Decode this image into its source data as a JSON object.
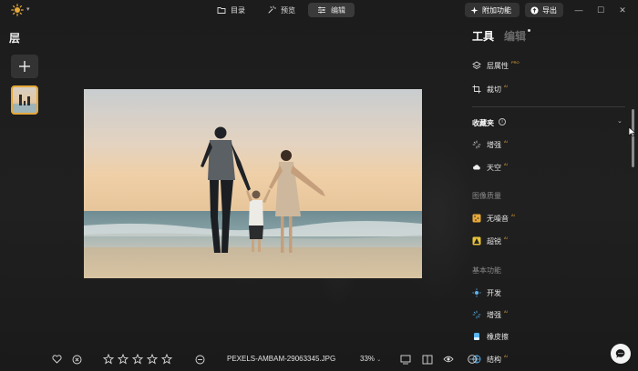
{
  "app": {
    "logo_icon": "sun-logo-icon",
    "accent_color": "#e6a83a"
  },
  "topbar": {
    "tabs": [
      {
        "label": "目录",
        "icon": "folder-icon",
        "active": false
      },
      {
        "label": "预览",
        "icon": "sparkle-wand-icon",
        "active": false
      },
      {
        "label": "编辑",
        "icon": "sliders-icon",
        "active": true
      }
    ],
    "addon_label": "附加功能",
    "export_label": "导出"
  },
  "left_panel": {
    "title": "层"
  },
  "right_panel": {
    "tab_tools": "工具",
    "tab_edit": "编辑",
    "items_top": [
      {
        "label": "层属性",
        "badge": "PRO",
        "icon": "layers-icon"
      },
      {
        "label": "裁切",
        "badge": "AI",
        "icon": "crop-icon"
      }
    ],
    "favorites_title": "收藏夹",
    "favorites": [
      {
        "label": "增强",
        "badge": "AI",
        "icon": "enhance-sparkle-icon"
      },
      {
        "label": "天空",
        "badge": "AI",
        "icon": "cloud-icon"
      }
    ],
    "quality_title": "图像质量",
    "quality": [
      {
        "label": "无噪音",
        "badge": "AI",
        "icon": "denoise-icon"
      },
      {
        "label": "超锐",
        "badge": "AI",
        "icon": "sharpen-icon"
      }
    ],
    "basic_title": "基本功能",
    "basic": [
      {
        "label": "开发",
        "icon": "develop-sun-icon"
      },
      {
        "label": "增强",
        "badge": "AI",
        "icon": "enhance-sparkle-icon"
      },
      {
        "label": "橡皮擦",
        "icon": "eraser-icon"
      },
      {
        "label": "结构",
        "badge": "AI",
        "icon": "structure-icon"
      }
    ]
  },
  "bottombar": {
    "filename": "PEXELS-AMBAM-29063345.JPG",
    "zoom": "33%",
    "rating_max": 5
  }
}
